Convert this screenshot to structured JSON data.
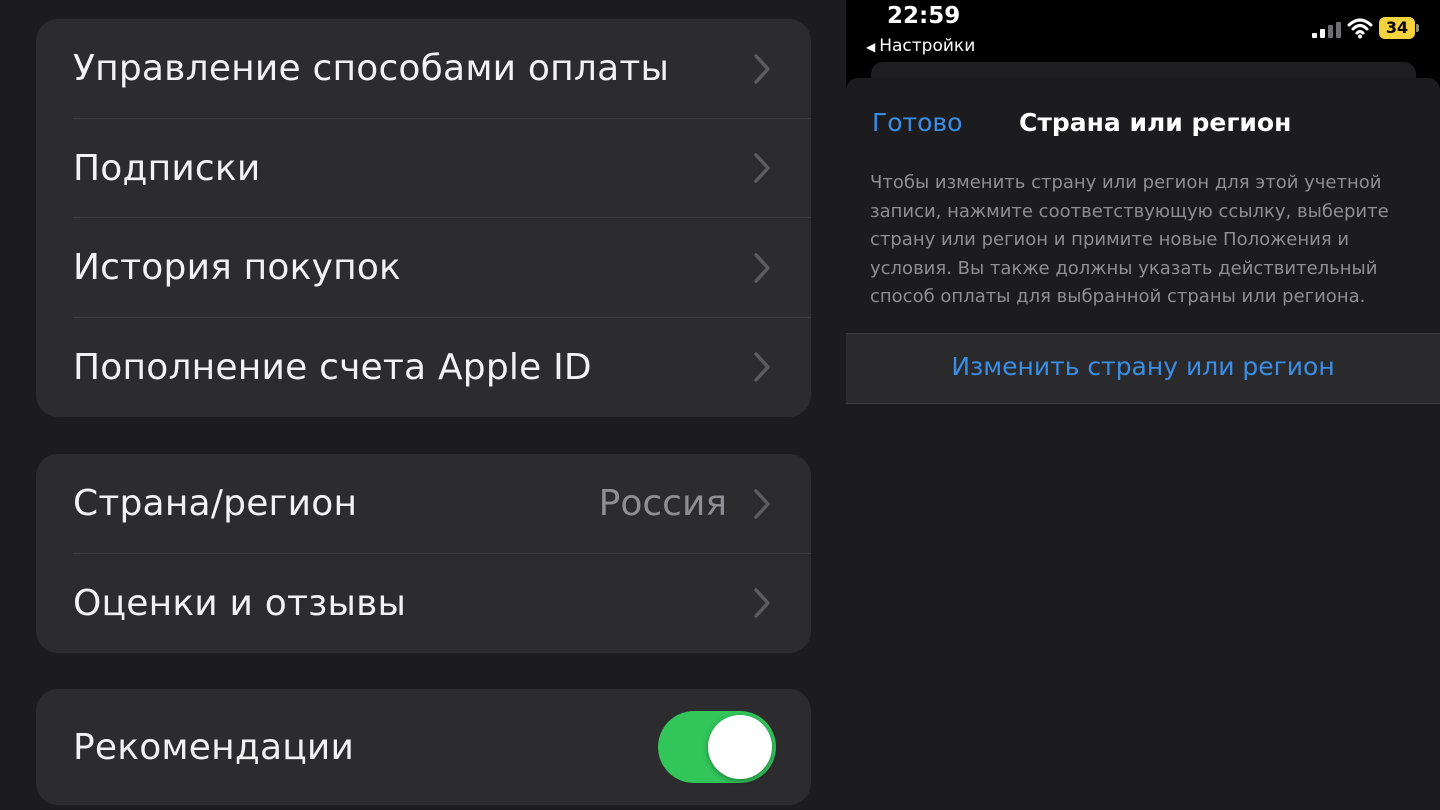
{
  "settings": {
    "group1": [
      {
        "label": "Управление способами оплаты"
      },
      {
        "label": "Подписки"
      },
      {
        "label": "История покупок"
      },
      {
        "label": "Пополнение счета Apple ID"
      }
    ],
    "group2": [
      {
        "label": "Страна/регион",
        "value": "Россия"
      },
      {
        "label": "Оценки и отзывы"
      }
    ],
    "group3": {
      "label": "Рекомендации",
      "toggle_on": true
    }
  },
  "phone": {
    "status": {
      "time": "22:59",
      "back_label": "Настройки",
      "battery": "34"
    },
    "sheet": {
      "done_label": "Готово",
      "title": "Страна или регион",
      "description": "Чтобы изменить страну или регион для этой учетной записи, нажмите соответствующую ссылку, выберите страну или регион и примите новые Положения и условия. Вы также должны указать действительный способ оплаты для выбранной страны или региона.",
      "action_label": "Изменить страну или регион"
    }
  },
  "colors": {
    "accent_blue": "#3a8ee6",
    "toggle_green": "#32c55a",
    "battery_yellow": "#f5d33f"
  }
}
